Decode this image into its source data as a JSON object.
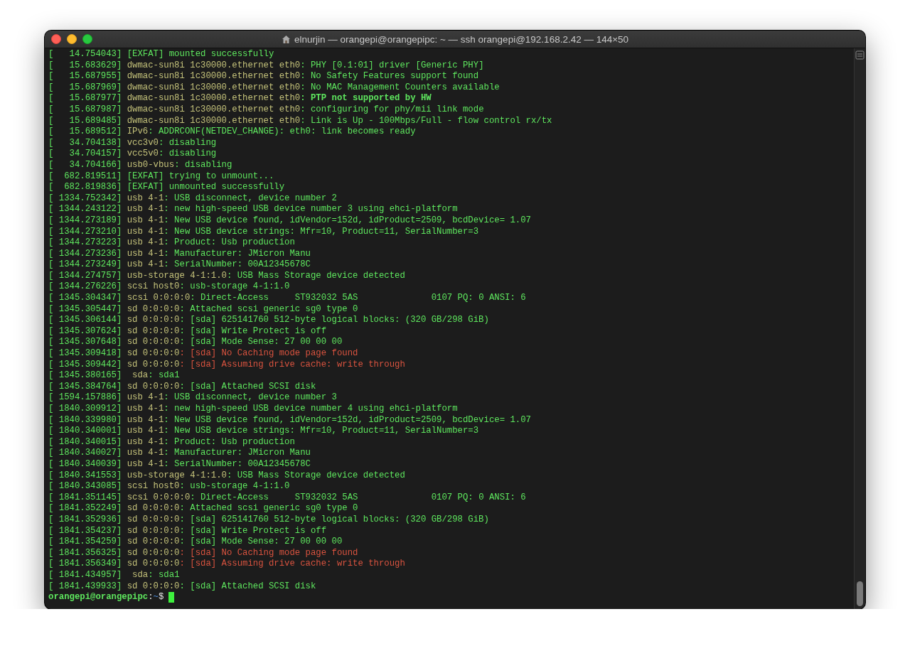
{
  "window": {
    "title": "elnurjin — orangepi@orangepipc: ~ — ssh orangepi@192.168.2.42 — 144×50"
  },
  "lines": [
    {
      "timestamp": "[   14.754043]",
      "message": "[EXFAT] mounted successfully",
      "kind": "plain"
    },
    {
      "timestamp": "[   15.683629]",
      "source": "dwmac-sun8i 1c30000.ethernet eth0",
      "message": ": PHY [0.1:01] driver [Generic PHY]",
      "kind": "plain"
    },
    {
      "timestamp": "[   15.687955]",
      "source": "dwmac-sun8i 1c30000.ethernet eth0",
      "message": ": No Safety Features support found",
      "kind": "plain"
    },
    {
      "timestamp": "[   15.687969]",
      "source": "dwmac-sun8i 1c30000.ethernet eth0",
      "message": ": No MAC Management Counters available",
      "kind": "plain"
    },
    {
      "timestamp": "[   15.687977]",
      "source": "dwmac-sun8i 1c30000.ethernet eth0",
      "message": ": PTP not supported by HW",
      "kind": "notice"
    },
    {
      "timestamp": "[   15.687987]",
      "source": "dwmac-sun8i 1c30000.ethernet eth0",
      "message": ": configuring for phy/mii link mode",
      "kind": "plain"
    },
    {
      "timestamp": "[   15.689485]",
      "source": "dwmac-sun8i 1c30000.ethernet eth0",
      "message": ": Link is Up - 100Mbps/Full - flow control rx/tx",
      "kind": "plain"
    },
    {
      "timestamp": "[   15.689512]",
      "source": "IPv6",
      "message": ": ADDRCONF(NETDEV_CHANGE): eth0: link becomes ready",
      "kind": "plain"
    },
    {
      "timestamp": "[   34.704138]",
      "source": "vcc3v0",
      "message": ": disabling",
      "kind": "plain"
    },
    {
      "timestamp": "[   34.704157]",
      "source": "vcc5v0",
      "message": ": disabling",
      "kind": "plain"
    },
    {
      "timestamp": "[   34.704166]",
      "source": "usb0-vbus",
      "message": ": disabling",
      "kind": "plain"
    },
    {
      "timestamp": "[  682.819511]",
      "message": "[EXFAT] trying to unmount...",
      "kind": "plain"
    },
    {
      "timestamp": "[  682.819836]",
      "message": "[EXFAT] unmounted successfully",
      "kind": "plain"
    },
    {
      "timestamp": "[ 1334.752342]",
      "source": "usb 4-1",
      "message": ": USB disconnect, device number 2",
      "kind": "plain"
    },
    {
      "timestamp": "[ 1344.243122]",
      "source": "usb 4-1",
      "message": ": new high-speed USB device number 3 using ehci-platform",
      "kind": "plain"
    },
    {
      "timestamp": "[ 1344.273189]",
      "source": "usb 4-1",
      "message": ": New USB device found, idVendor=152d, idProduct=2509, bcdDevice= 1.07",
      "kind": "plain"
    },
    {
      "timestamp": "[ 1344.273210]",
      "source": "usb 4-1",
      "message": ": New USB device strings: Mfr=10, Product=11, SerialNumber=3",
      "kind": "plain"
    },
    {
      "timestamp": "[ 1344.273223]",
      "source": "usb 4-1",
      "message": ": Product: Usb production",
      "kind": "plain"
    },
    {
      "timestamp": "[ 1344.273236]",
      "source": "usb 4-1",
      "message": ": Manufacturer: JMicron Manu",
      "kind": "plain"
    },
    {
      "timestamp": "[ 1344.273249]",
      "source": "usb 4-1",
      "message": ": SerialNumber: 00A12345678C",
      "kind": "plain"
    },
    {
      "timestamp": "[ 1344.274757]",
      "source": "usb-storage 4-1:1.0",
      "message": ": USB Mass Storage device detected",
      "kind": "plain"
    },
    {
      "timestamp": "[ 1344.276226]",
      "source": "scsi host0",
      "message": ": usb-storage 4-1:1.0",
      "kind": "plain"
    },
    {
      "timestamp": "[ 1345.304347]",
      "source": "scsi 0:0:0:0",
      "message": ": Direct-Access     ST932032 5AS              0107 PQ: 0 ANSI: 6",
      "kind": "plain"
    },
    {
      "timestamp": "[ 1345.305447]",
      "source": "sd 0:0:0:0",
      "message": ": Attached scsi generic sg0 type 0",
      "kind": "plain"
    },
    {
      "timestamp": "[ 1345.306144]",
      "source": "sd 0:0:0:0",
      "message": ": [sda] 625141760 512-byte logical blocks: (320 GB/298 GiB)",
      "kind": "plain"
    },
    {
      "timestamp": "[ 1345.307624]",
      "source": "sd 0:0:0:0",
      "message": ": [sda] Write Protect is off",
      "kind": "plain"
    },
    {
      "timestamp": "[ 1345.307648]",
      "source": "sd 0:0:0:0",
      "message": ": [sda] Mode Sense: 27 00 00 00",
      "kind": "plain"
    },
    {
      "timestamp": "[ 1345.309418]",
      "source": "sd 0:0:0:0",
      "message": ": [sda] No Caching mode page found",
      "kind": "warning"
    },
    {
      "timestamp": "[ 1345.309442]",
      "source": "sd 0:0:0:0",
      "message": ": [sda] Assuming drive cache: write through",
      "kind": "warning"
    },
    {
      "timestamp": "[ 1345.380165]",
      "source": " sda",
      "message": ": sda1",
      "kind": "plain"
    },
    {
      "timestamp": "[ 1345.384764]",
      "source": "sd 0:0:0:0",
      "message": ": [sda] Attached SCSI disk",
      "kind": "plain"
    },
    {
      "timestamp": "[ 1594.157886]",
      "source": "usb 4-1",
      "message": ": USB disconnect, device number 3",
      "kind": "plain"
    },
    {
      "timestamp": "[ 1840.309912]",
      "source": "usb 4-1",
      "message": ": new high-speed USB device number 4 using ehci-platform",
      "kind": "plain"
    },
    {
      "timestamp": "[ 1840.339980]",
      "source": "usb 4-1",
      "message": ": New USB device found, idVendor=152d, idProduct=2509, bcdDevice= 1.07",
      "kind": "plain"
    },
    {
      "timestamp": "[ 1840.340001]",
      "source": "usb 4-1",
      "message": ": New USB device strings: Mfr=10, Product=11, SerialNumber=3",
      "kind": "plain"
    },
    {
      "timestamp": "[ 1840.340015]",
      "source": "usb 4-1",
      "message": ": Product: Usb production",
      "kind": "plain"
    },
    {
      "timestamp": "[ 1840.340027]",
      "source": "usb 4-1",
      "message": ": Manufacturer: JMicron Manu",
      "kind": "plain"
    },
    {
      "timestamp": "[ 1840.340039]",
      "source": "usb 4-1",
      "message": ": SerialNumber: 00A12345678C",
      "kind": "plain"
    },
    {
      "timestamp": "[ 1840.341553]",
      "source": "usb-storage 4-1:1.0",
      "message": ": USB Mass Storage device detected",
      "kind": "plain"
    },
    {
      "timestamp": "[ 1840.343085]",
      "source": "scsi host0",
      "message": ": usb-storage 4-1:1.0",
      "kind": "plain"
    },
    {
      "timestamp": "[ 1841.351145]",
      "source": "scsi 0:0:0:0",
      "message": ": Direct-Access     ST932032 5AS              0107 PQ: 0 ANSI: 6",
      "kind": "plain"
    },
    {
      "timestamp": "[ 1841.352249]",
      "source": "sd 0:0:0:0",
      "message": ": Attached scsi generic sg0 type 0",
      "kind": "plain"
    },
    {
      "timestamp": "[ 1841.352936]",
      "source": "sd 0:0:0:0",
      "message": ": [sda] 625141760 512-byte logical blocks: (320 GB/298 GiB)",
      "kind": "plain"
    },
    {
      "timestamp": "[ 1841.354237]",
      "source": "sd 0:0:0:0",
      "message": ": [sda] Write Protect is off",
      "kind": "plain"
    },
    {
      "timestamp": "[ 1841.354259]",
      "source": "sd 0:0:0:0",
      "message": ": [sda] Mode Sense: 27 00 00 00",
      "kind": "plain"
    },
    {
      "timestamp": "[ 1841.356325]",
      "source": "sd 0:0:0:0",
      "message": ": [sda] No Caching mode page found",
      "kind": "warning"
    },
    {
      "timestamp": "[ 1841.356349]",
      "source": "sd 0:0:0:0",
      "message": ": [sda] Assuming drive cache: write through",
      "kind": "warning"
    },
    {
      "timestamp": "[ 1841.434957]",
      "source": " sda",
      "message": ": sda1",
      "kind": "plain"
    },
    {
      "timestamp": "[ 1841.439933]",
      "source": "sd 0:0:0:0",
      "message": ": [sda] Attached SCSI disk",
      "kind": "plain"
    }
  ],
  "prompt": {
    "user_host": "orangepi@orangepipc",
    "separator": ":",
    "path": "~",
    "symbol": "$"
  }
}
